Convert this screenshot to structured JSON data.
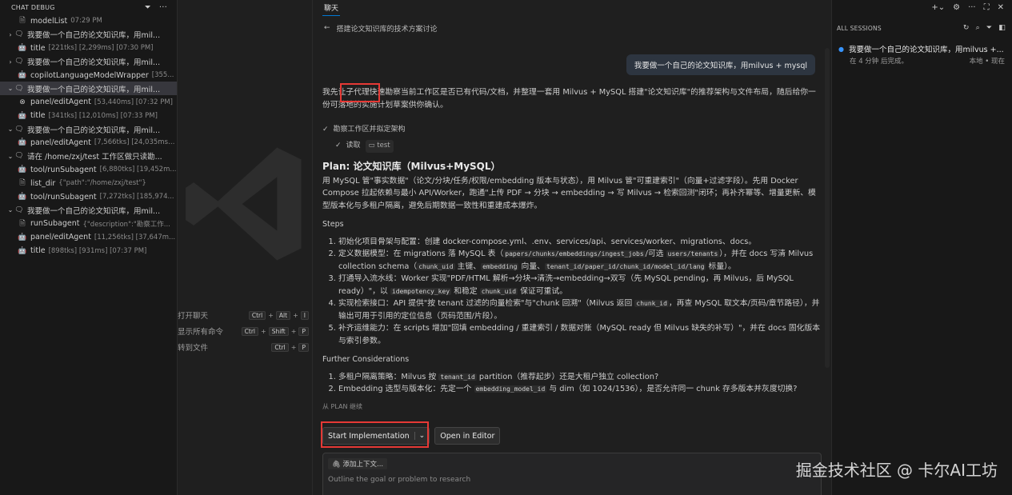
{
  "debug": {
    "title": "CHAT DEBUG",
    "rows": [
      {
        "chev": "",
        "icon": "🗎",
        "label": "modelList",
        "meta": "07:29 PM",
        "indent": 1
      },
      {
        "chev": "›",
        "icon": "🗨",
        "label": "我要做一个自己的论文知识库，用mil...",
        "meta": "",
        "indent": 0
      },
      {
        "chev": "",
        "icon": "🤖",
        "label": "title",
        "meta": "[221tks] [2,299ms] [07:30 PM]",
        "indent": 1
      },
      {
        "chev": "›",
        "icon": "🗨",
        "label": "我要做一个自己的论文知识库，用mil...",
        "meta": "",
        "indent": 0
      },
      {
        "chev": "",
        "icon": "🤖",
        "label": "copilotLanguageModelWrapper",
        "meta": "[355...",
        "indent": 1
      },
      {
        "chev": "⌄",
        "icon": "🗨",
        "label": "我要做一个自己的论文知识库，用mil...",
        "meta": "",
        "indent": 0,
        "selected": true
      },
      {
        "chev": "",
        "icon": "⊗",
        "label": "panel/editAgent",
        "meta": "[53,440ms] [07:32 PM]",
        "indent": 1
      },
      {
        "chev": "",
        "icon": "🤖",
        "label": "title",
        "meta": "[341tks] [12,010ms] [07:33 PM]",
        "indent": 1
      },
      {
        "chev": "⌄",
        "icon": "🗨",
        "label": "我要做一个自己的论文知识库，用mil...",
        "meta": "",
        "indent": 0
      },
      {
        "chev": "",
        "icon": "🤖",
        "label": "panel/editAgent",
        "meta": "[7,566tks] [24,035ms]...",
        "indent": 1
      },
      {
        "chev": "⌄",
        "icon": "🗨",
        "label": "请在 /home/zxj/test 工作区做只读勘...",
        "meta": "",
        "indent": 0
      },
      {
        "chev": "",
        "icon": "🤖",
        "label": "tool/runSubagent",
        "meta": "[6,880tks] [19,452m...",
        "indent": 1
      },
      {
        "chev": "",
        "icon": "🗎",
        "label": "list_dir",
        "meta": "{\"path\":\"/home/zxj/test\"}",
        "indent": 1
      },
      {
        "chev": "",
        "icon": "🤖",
        "label": "tool/runSubagent",
        "meta": "[7,272tks] [185,974...",
        "indent": 1
      },
      {
        "chev": "⌄",
        "icon": "🗨",
        "label": "我要做一个自己的论文知识库，用mil...",
        "meta": "",
        "indent": 0
      },
      {
        "chev": "",
        "icon": "🗎",
        "label": "runSubagent",
        "meta": "{\"description\":\"勘察工作...",
        "indent": 1
      },
      {
        "chev": "",
        "icon": "🤖",
        "label": "panel/editAgent",
        "meta": "[11,256tks] [37,647m...",
        "indent": 1
      },
      {
        "chev": "",
        "icon": "🤖",
        "label": "title",
        "meta": "[898tks] [931ms] [07:37 PM]",
        "indent": 1
      }
    ]
  },
  "shortcuts": [
    {
      "label": "打开聊天",
      "keys": [
        "Ctrl",
        "Alt",
        "I"
      ]
    },
    {
      "label": "显示所有命令",
      "keys": [
        "Ctrl",
        "Shift",
        "P"
      ]
    },
    {
      "label": "转到文件",
      "keys": [
        "Ctrl",
        "P"
      ]
    }
  ],
  "chat": {
    "tab": "聊天",
    "title": "搭建论文知识库的技术方案讨论",
    "user_message": "我要做一个自己的论文知识库，用milvus + mysql",
    "intro": "我先让子代理快速勘察当前工作区是否已有代码/文档，并整理一套用 Milvus + MySQL 搭建\"论文知识库\"的推荐架构与文件布局，随后给你一份可落地的实施计划草案供你确认。",
    "step1": "勘察工作区并拟定架构",
    "step2_label": "读取",
    "step2_tag": "test",
    "plan_title": "Plan: 论文知识库（Milvus+MySQL）",
    "plan_desc": "用 MySQL 管\"事实数据\"（论文/分块/任务/权限/embedding 版本与状态），用 Milvus 管\"可重建索引\"（向量+过滤字段）。先用 Docker Compose 拉起依赖与最小 API/Worker，跑通\"上传 PDF → 分块 → embedding → 写 Milvus → 检索回测\"闭环；再补齐幂等、增量更新、模型版本化与多租户隔离，避免后期数据一致性和重建成本爆炸。",
    "steps_heading": "Steps",
    "s1": "初始化项目骨架与配置：创建 docker-compose.yml、.env、services/api、services/worker、migrations、docs。",
    "s2a": "定义数据模型：在 migrations 落 MySQL 表（",
    "s2_code1": "papers/chunks/embeddings/ingest_jobs",
    "s2b": "/可选 ",
    "s2_code2": "users/tenants",
    "s2c": "），并在 docs 写清 Milvus collection schema（",
    "s2_code3": "chunk_uid",
    "s2d": " 主键、",
    "s2_code4": "embedding",
    "s2e": " 向量、",
    "s2_code5": "tenant_id/paper_id/chunk_id/model_id/lang",
    "s2f": " 标量）。",
    "s3a": "打通导入流水线：Worker 实现\"PDF/HTML 解析→分块→清洗→embedding→双写（先 MySQL pending，再 Milvus，后 MySQL ready）\"，以 ",
    "s3_code1": "idempotency_key",
    "s3b": " 和稳定 ",
    "s3_code2": "chunk_uid",
    "s3c": " 保证可重试。",
    "s4a": "实现检索接口：API 提供\"按 tenant 过滤的向量检索\"与\"chunk 回溯\"（Milvus 返回 ",
    "s4_code": "chunk_id",
    "s4b": "，再查 MySQL 取文本/页码/章节路径），并输出可用于引用的定位信息（页码范围/片段）。",
    "s5": "补齐运维能力：在 scripts 增加\"回填 embedding / 重建索引 / 数据对账（MySQL ready 但 Milvus 缺失的补写）\"，并在 docs 固化版本与索引参数。",
    "further_heading": "Further Considerations",
    "f1a": "多租户隔离策略：Milvus 按 ",
    "f1_code": "tenant_id",
    "f1b": " partition（推荐起步）还是大租户独立 collection?",
    "f2a": "Embedding 选型与版本化：先定一个 ",
    "f2_code": "embedding_model_id",
    "f2b": " 与 dim（如 1024/1536），是否允许同一 chunk 存多版本并灰度切换?",
    "handoff": "从 PLAN 继续",
    "start_btn": "Start Implementation",
    "editor_btn": "Open in Editor",
    "context_btn": "添加上下文...",
    "input_placeholder": "Outline the goal or problem to research"
  },
  "sessions": {
    "title": "ALL SESSIONS",
    "item_title": "我要做一个自己的论文知识库，用milvus +...",
    "item_status": "在 4 分钟 后完成。",
    "item_meta": "本地 • 现在"
  },
  "watermark": "掘金技术社区 @ 卡尔AI工坊",
  "colors": {
    "accent": "#0078d4",
    "highlight": "#e53935",
    "session_dot": "#3794ff"
  }
}
